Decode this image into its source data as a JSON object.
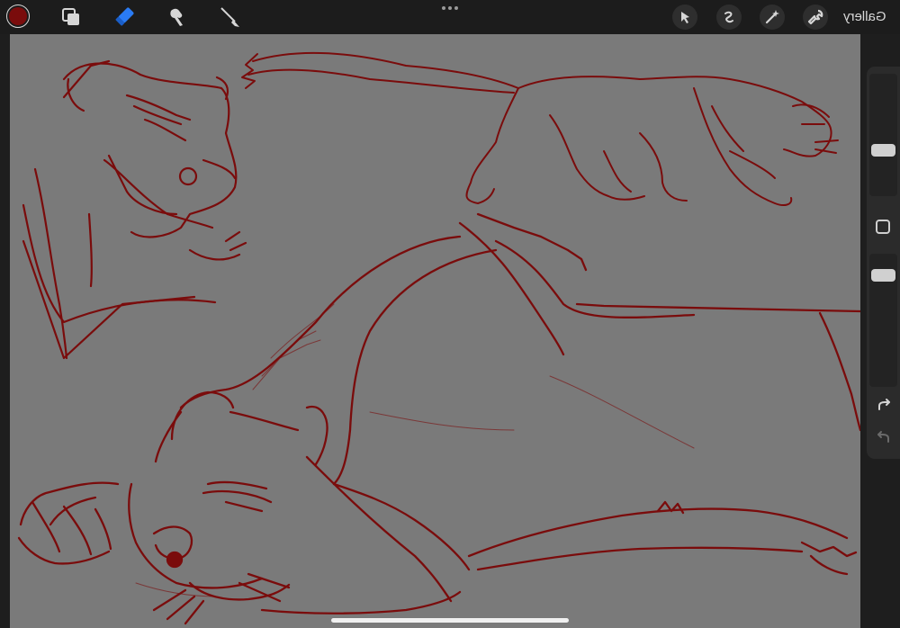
{
  "toolbar": {
    "color_swatch": {
      "color": "#7a0c0c"
    },
    "left_tools": [
      {
        "name": "layers-icon"
      },
      {
        "name": "brush-icon",
        "active_color": "#2a7bf4"
      },
      {
        "name": "smudge-icon"
      },
      {
        "name": "eraser-icon"
      }
    ],
    "more_menu": "more-dots-icon",
    "right_tools": [
      {
        "name": "selection-arrow-icon"
      },
      {
        "name": "transform-icon"
      },
      {
        "name": "adjustments-wand-icon"
      },
      {
        "name": "actions-wrench-icon"
      }
    ],
    "gallery_label": "Gallery"
  },
  "sidebar": {
    "brush_size_level": 0.65,
    "opacity_level": 0.1,
    "modify_icon": "square-icon",
    "redo_icon": "redo-icon",
    "undo_icon": "undo-icon"
  },
  "canvas": {
    "background": "#7a7a7a",
    "stroke_color": "#7a0c0c"
  }
}
